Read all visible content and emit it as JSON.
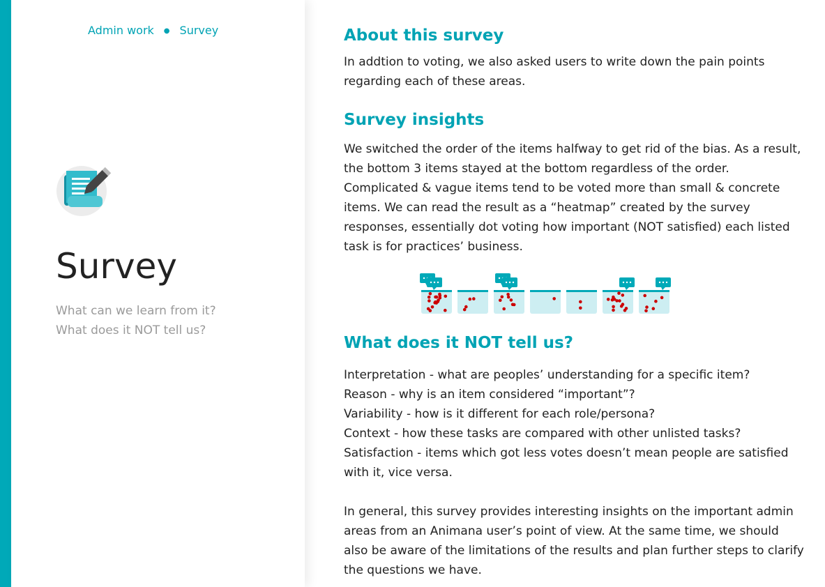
{
  "breadcrumb": {
    "item1": "Admin work",
    "item2": "Survey"
  },
  "sidebar": {
    "icon": "scroll-pen-icon",
    "title": "Survey",
    "questions": [
      "What can we learn from it?",
      "What does it NOT tell us?"
    ]
  },
  "colors": {
    "accent": "#00a9b8",
    "heading": "#00a3b4",
    "dot": "#cc0000",
    "box": "#cdeef2"
  },
  "main": {
    "about": {
      "heading": "About this survey",
      "lines": [
        "In addtion to voting, we also asked users to write down the pain points",
        "regarding each of these areas."
      ]
    },
    "insights": {
      "heading": "Survey insights",
      "lines": [
        "We switched the order of the items halfway to get rid of the bias. As a result,",
        "the bottom 3 items stayed at the bottom regardless of the order.",
        "Complicated & vague items tend to be voted more than small & concrete",
        "items. We can read the result as a “heatmap” created by the survey",
        "responses, essentially dot voting how important (NOT satisfied) each listed",
        "task is for practices’ business."
      ]
    },
    "not_tell": {
      "heading": "What does it NOT tell us?",
      "lines": [
        "Interpretation - what are peoples’ understanding for a specific item?",
        "Reason - why is an item considered “important”?",
        "Variability -  how is it different for each role/persona?",
        "Context - how these tasks are compared with other unlisted tasks?",
        "Satisfaction - items which got less votes doesn’t mean people are satisfied",
        "with it, vice versa."
      ]
    },
    "general": {
      "lines": [
        "In general, this survey provides interesting insights on the important admin",
        "areas from an Animana user’s point of view. At the same time, we should",
        "also be aware of the limitations of the results and plan further steps to clarify",
        "the questions we have."
      ]
    }
  }
}
